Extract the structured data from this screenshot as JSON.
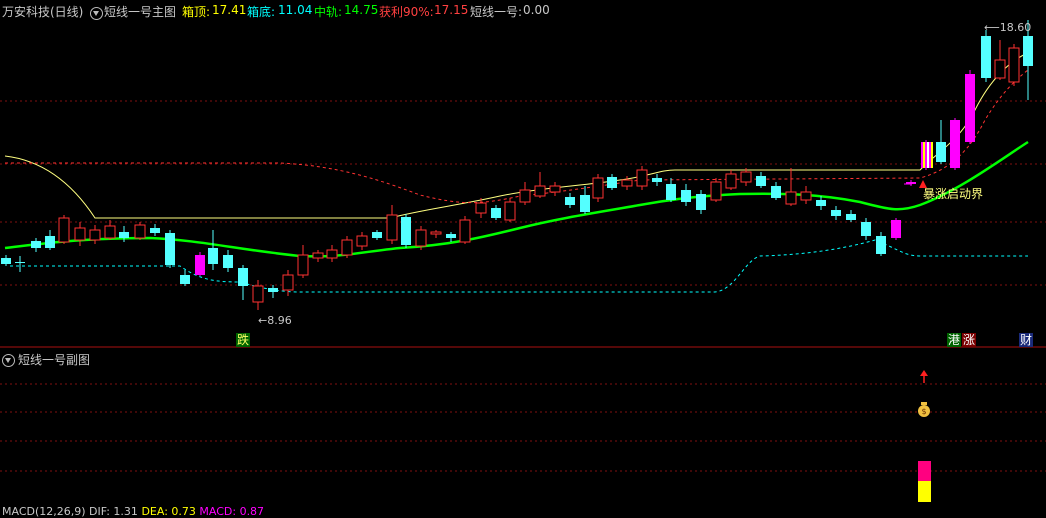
{
  "header": {
    "stock_title": "万安科技(日线)",
    "indicator_name": "短线一号主图",
    "values": [
      {
        "label": "箱顶:",
        "value": "17.41",
        "color": "#ffff00"
      },
      {
        "label": "箱底:",
        "value": "11.04",
        "color": "#00ffff"
      },
      {
        "label": "中轨:",
        "value": "14.75",
        "color": "#00ff00"
      },
      {
        "label": "获利90%:",
        "value": "17.15",
        "color": "#ff4040"
      },
      {
        "label": "短线一号:",
        "value": "0.00",
        "color": "#c8c8c8"
      }
    ]
  },
  "main_chart": {
    "high_label": "18.60",
    "low_label": "8.96",
    "annotation": "暴涨启动界",
    "bottom_tags": [
      {
        "text": "跌",
        "bg": "#006400",
        "fg": "#ffff66"
      },
      {
        "text": "港",
        "bg": "#006400",
        "fg": "#ffffff"
      },
      {
        "text": "涨",
        "bg": "#7a0000",
        "fg": "#ffffff"
      },
      {
        "text": "财",
        "bg": "#1a2a7a",
        "fg": "#ffffff"
      }
    ]
  },
  "sub_chart": {
    "title": "短线一号副图",
    "money_icon": "money-bag-icon"
  },
  "macd_bar": {
    "label": "MACD(12,26,9)",
    "dif_label": "DIF: 1.31",
    "dea_label": "DEA: 0.73",
    "macd_label": "MACD: 0.87"
  },
  "colors": {
    "up_candle": "#ff3232",
    "down_candle": "#54ffff",
    "boll_mid": "#00ff00",
    "upper_line": "#ffff80",
    "lower_dashed": "#00ffff",
    "red_dashed": "#ff3232",
    "magenta": "#ff00ff",
    "grid": "#801010"
  }
}
